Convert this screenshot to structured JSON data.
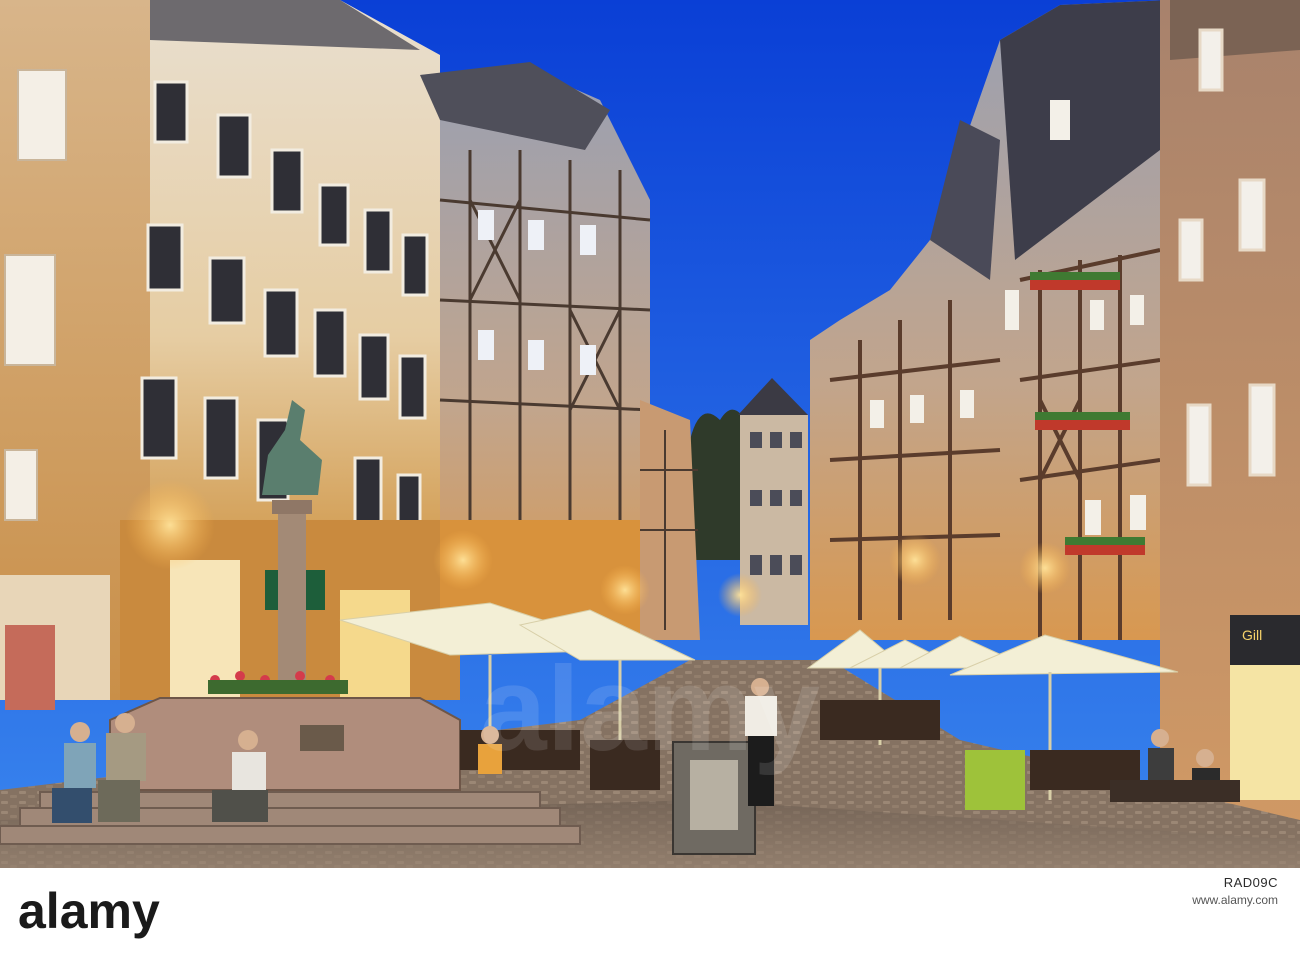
{
  "photo": {
    "subject": "town-square-at-dusk",
    "colors": {
      "sky_top": "#0a3fd6",
      "sky_bottom": "#2a73e8",
      "lamp_glow": "#ffc65a",
      "cobble": "#8a7866"
    }
  },
  "storefront_sign": {
    "text": "Gill"
  },
  "watermark": {
    "text": "alamy"
  },
  "banner": {
    "logo_text": "alamy",
    "image_id": "RAD09C",
    "credit": "www.alamy.com"
  }
}
